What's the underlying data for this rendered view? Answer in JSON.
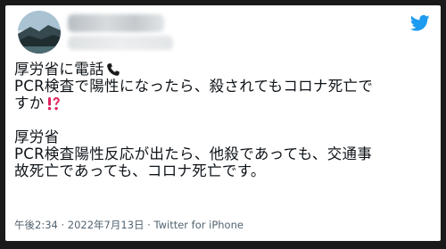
{
  "tweet": {
    "line1": "厚労省に電話",
    "line2": "PCR検査で陽性になったら、殺されてもコロナ死亡で",
    "line3": "すか",
    "line4": "厚労省",
    "line5": "PCR検査陽性反応が出たら、他殺であっても、交通事",
    "line6": "故死亡であっても、コロナ死亡です。"
  },
  "footer": {
    "timestamp": "午後2:34 · 2022年7月13日 · Twitter for iPhone"
  },
  "icons": {
    "phone": "phone-icon",
    "exclamation_question": "exclamation-question-icon",
    "bird": "twitter-bird-icon"
  },
  "colors": {
    "text": "#0f1419",
    "muted": "#536471",
    "twitter_blue": "#1d9bf0",
    "emoji_red": "#e0245e"
  }
}
